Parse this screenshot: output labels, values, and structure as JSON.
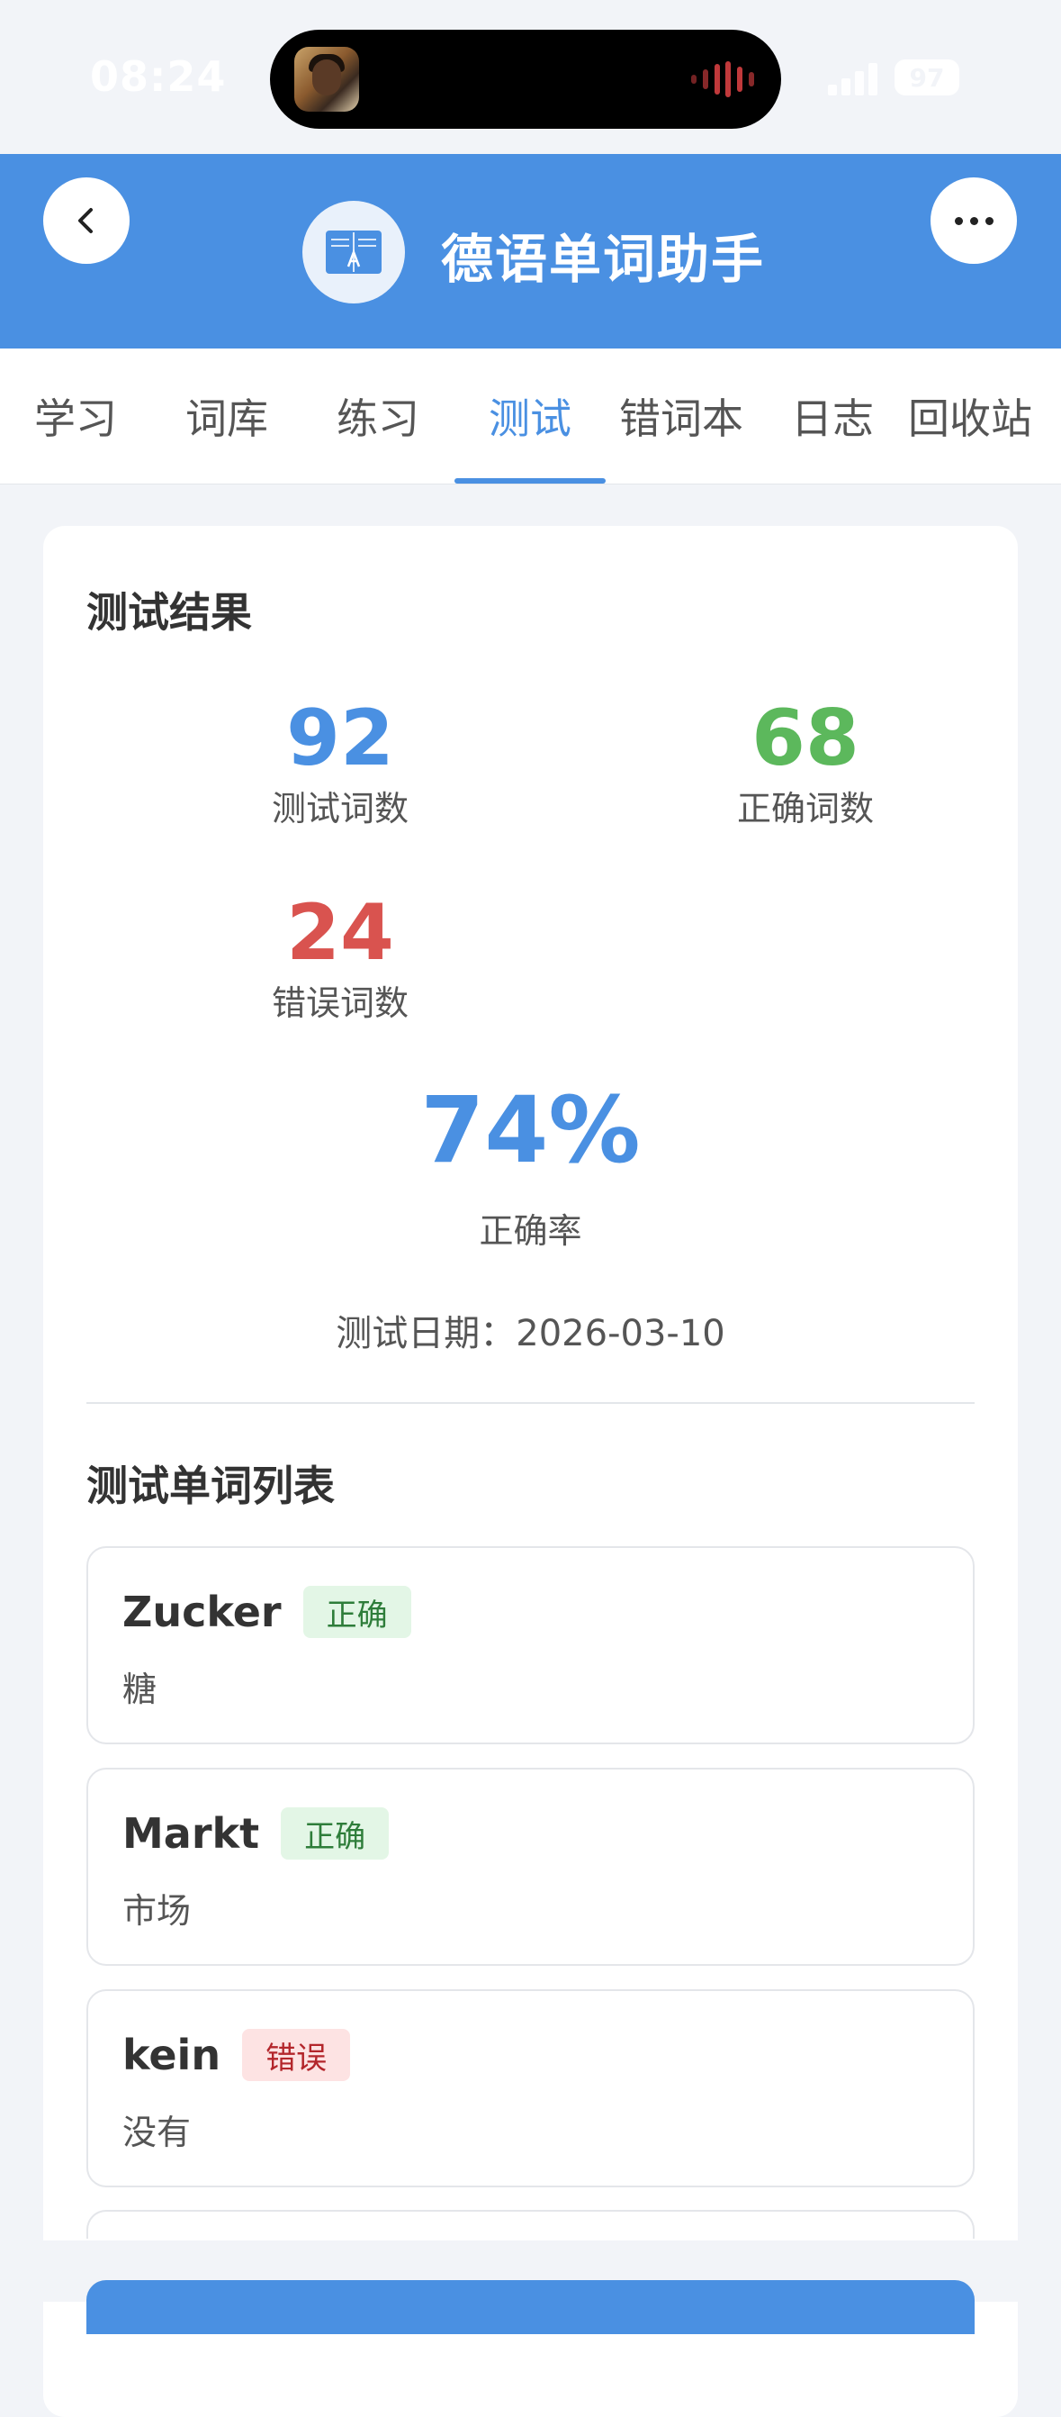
{
  "status_bar": {
    "time": "08:24",
    "battery": "97"
  },
  "header": {
    "title": "德语单词助手"
  },
  "tabs": [
    {
      "label": "学习"
    },
    {
      "label": "词库"
    },
    {
      "label": "练习"
    },
    {
      "label": "测试",
      "active": true
    },
    {
      "label": "错词本"
    },
    {
      "label": "日志"
    },
    {
      "label": "回收站"
    }
  ],
  "result": {
    "title": "测试结果",
    "tested_count": "92",
    "tested_label": "测试词数",
    "correct_count": "68",
    "correct_label": "正确词数",
    "wrong_count": "24",
    "wrong_label": "错误词数",
    "accuracy": "74%",
    "accuracy_label": "正确率",
    "date_label": "测试日期：",
    "date_value": "2026-03-10"
  },
  "word_list": {
    "title": "测试单词列表",
    "items": [
      {
        "word": "Zucker",
        "status": "正确",
        "meaning": "糖"
      },
      {
        "word": "Markt",
        "status": "正确",
        "meaning": "市场"
      },
      {
        "word": "kein",
        "status": "错误",
        "meaning": "没有"
      }
    ]
  },
  "colors": {
    "primary": "#4a90e2",
    "correct": "#5cb85c",
    "wrong": "#d9534f"
  },
  "icons": {
    "back": "chevron-left-icon",
    "more": "more-horizontal-icon",
    "logo": "book-icon"
  }
}
